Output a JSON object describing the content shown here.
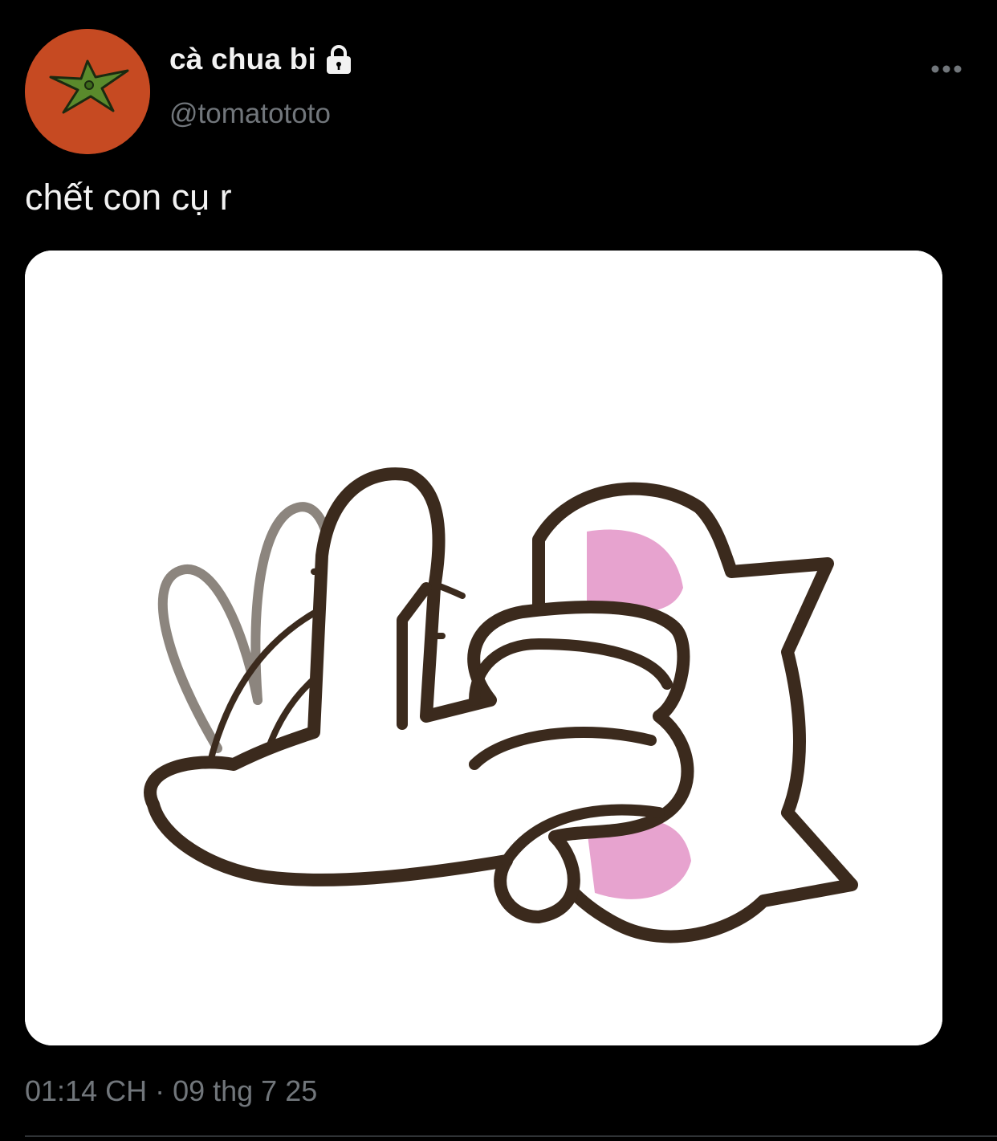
{
  "author": {
    "display_name": "cà chua bi",
    "handle": "@tomatototo",
    "avatar_icon": "tomato-avatar",
    "avatar_color": "#c64a22",
    "protected_icon": "lock-icon"
  },
  "more_icon": "ellipsis-icon",
  "tweet": {
    "text": "chết con cụ r",
    "media_description_icon": "cat-hug-sticker"
  },
  "timestamp": {
    "time": "01:14 CH",
    "separator": "·",
    "date": "09 thg 7 25"
  },
  "colors": {
    "background": "#000000",
    "primary_text": "#f2f2f2",
    "secondary_text": "#71767b",
    "divider": "#2f3336",
    "sticker_outline": "#3b2a1d",
    "sticker_blush": "#e7a3cf"
  }
}
